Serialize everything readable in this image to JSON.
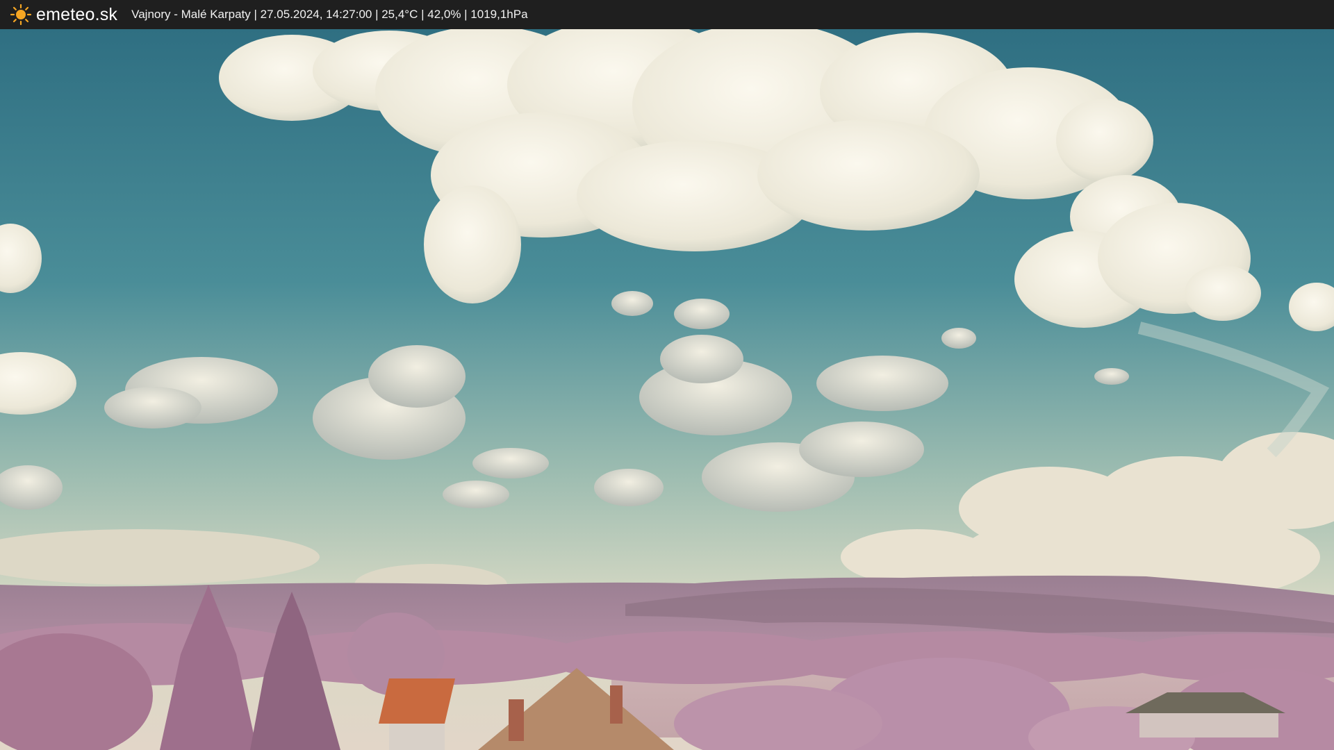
{
  "header": {
    "brand": "emeteo.sk",
    "caption": "Vajnory - Malé Karpaty | 27.05.2024, 14:27:00 | 25,4°C | 42,0% | 1019,1hPa",
    "logo_icon": "sun-icon"
  },
  "colors": {
    "bar": "#1f1f1f",
    "sun": "#f5a623",
    "sky_top": "#3a7f8e",
    "sky_horizon": "#cfd7c2",
    "hills": "#a9849a",
    "foliage": "#b98aa5",
    "roof": "#c96a3f"
  }
}
